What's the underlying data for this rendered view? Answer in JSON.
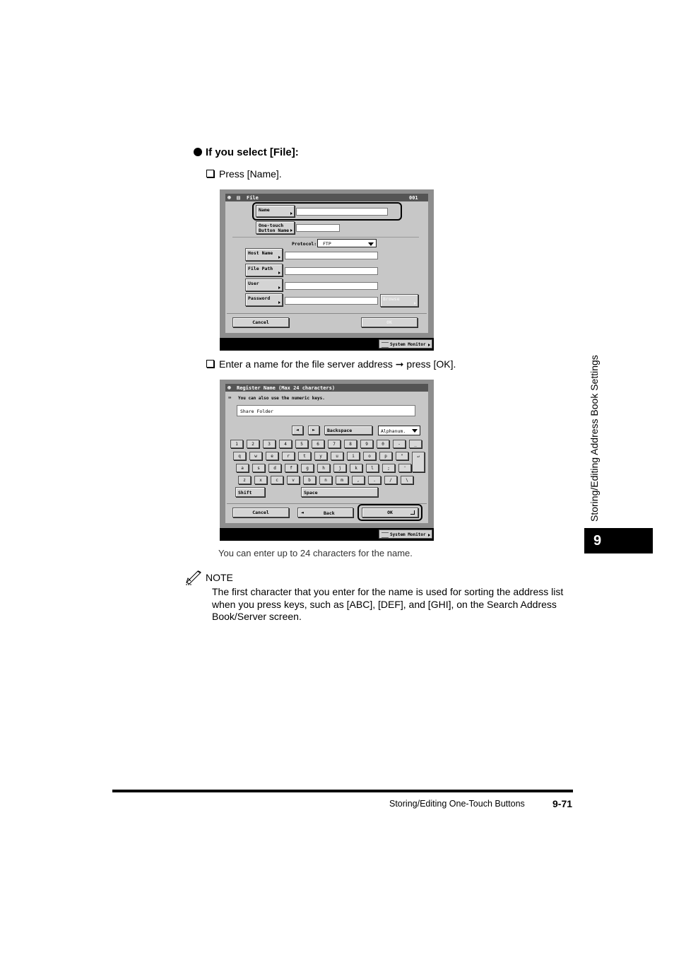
{
  "heading": "If you select [File]:",
  "step1": "Press [Name].",
  "step2": "Enter a name for the file server address ➞ press [OK].",
  "caption": "You can enter up to 24 characters for the name.",
  "note": {
    "label": "NOTE",
    "text": "The first character that you enter for the name is used for sorting the address list when you press keys, such as [ABC], [DEF], and [GHI], on the Search Address Book/Server screen."
  },
  "side_tab": {
    "text": "Storing/Editing Address Book Settings",
    "chapter": "9"
  },
  "footer": {
    "title": "Storing/Editing One-Touch Buttons",
    "page": "9-71"
  },
  "screen1": {
    "title": "File",
    "number": "001",
    "name_btn": "Name",
    "onetouch_btn_line1": "One-touch",
    "onetouch_btn_line2": "Button Name",
    "protocol_label": "Protocol:",
    "protocol_value": "FTP",
    "host_btn": "Host Name",
    "path_btn": "File Path",
    "user_btn": "User",
    "password_btn": "Password",
    "browse_btn": "Browse",
    "cancel_btn": "Cancel",
    "ok_btn": "OK",
    "system_monitor": "System Monitor"
  },
  "screen2": {
    "title": "Register Name (Max 24 characters)",
    "hint": "You can also use the numeric keys.",
    "input_value": "Share Folder",
    "left_arrow": "◄",
    "right_arrow": "►",
    "backspace": "Backspace",
    "mode": "Alphanum.",
    "row1": [
      "1",
      "2",
      "3",
      "4",
      "5",
      "6",
      "7",
      "8",
      "9",
      "0",
      "-",
      "_"
    ],
    "row2": [
      "q",
      "w",
      "e",
      "r",
      "t",
      "y",
      "u",
      "i",
      "o",
      "p",
      "\"",
      "↵"
    ],
    "row3": [
      "a",
      "s",
      "d",
      "f",
      "g",
      "h",
      "j",
      "k",
      "l",
      ";",
      "'"
    ],
    "row4": [
      "z",
      "x",
      "c",
      "v",
      "b",
      "n",
      "m",
      ",",
      ".",
      "/",
      "\\"
    ],
    "shift": "Shift",
    "space": "Space",
    "cancel_btn": "Cancel",
    "back_btn": "Back",
    "back_arrow": "◄",
    "ok_btn": "OK",
    "system_monitor": "System Monitor"
  }
}
